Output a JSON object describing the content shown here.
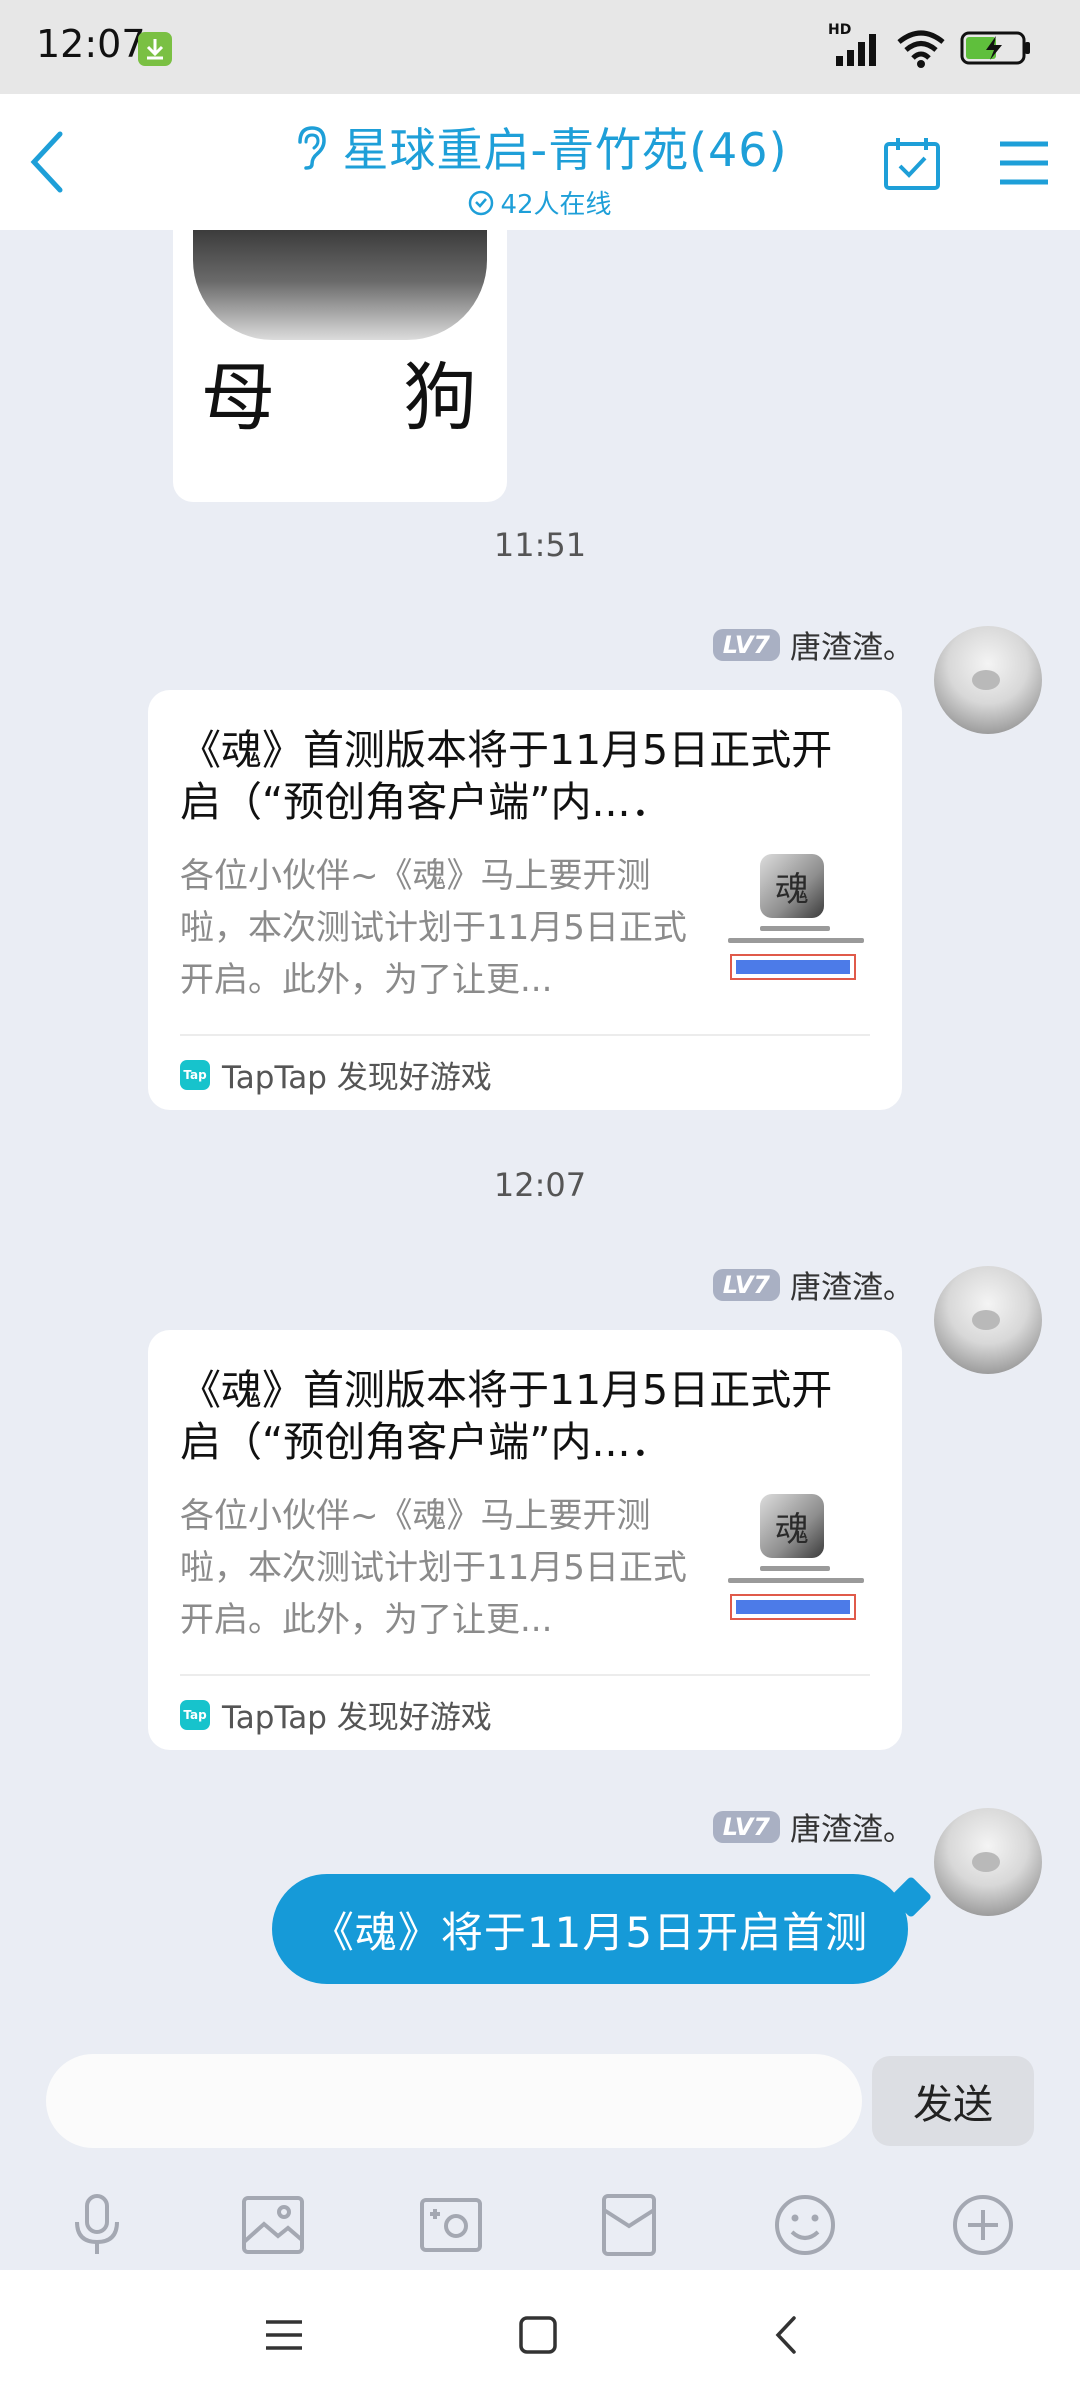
{
  "status_bar": {
    "time": "12:07",
    "network": "HD"
  },
  "header": {
    "title": "星球重启-青竹苑(46)",
    "online": "42人在线"
  },
  "chat": {
    "sticker_text_left": "母",
    "sticker_text_right": "狗",
    "timestamps": [
      "11:51",
      "12:07"
    ],
    "messages": [
      {
        "level": "LV7",
        "sender": "唐渣渣。",
        "card_title": "《魂》首测版本将于11月5日正式开启（“预创角客户端”内...．",
        "card_desc": "各位小伙伴~《魂》马上要开测啦，本次测试计划于11月5日正式开启。此外，为了让更...",
        "thumb_char": "魂",
        "source_logo": "Tap",
        "source": "TapTap 发现好游戏"
      },
      {
        "level": "LV7",
        "sender": "唐渣渣。",
        "card_title": "《魂》首测版本将于11月5日正式开启（“预创角客户端”内...．",
        "card_desc": "各位小伙伴~《魂》马上要开测啦，本次测试计划于11月5日正式开启。此外，为了让更...",
        "thumb_char": "魂",
        "source_logo": "Tap",
        "source": "TapTap 发现好游戏"
      },
      {
        "level": "LV7",
        "sender": "唐渣渣。",
        "text": "《魂》将于11月5日开启首测"
      }
    ]
  },
  "input": {
    "placeholder": "",
    "send_label": "发送"
  },
  "toolbar": {
    "items": [
      "mic-icon",
      "image-icon",
      "camera-icon",
      "red-packet-icon",
      "emoji-icon",
      "plus-icon"
    ]
  },
  "colors": {
    "accent": "#1e9fd8",
    "bubble": "#169ad8",
    "background": "#eaedf4"
  }
}
